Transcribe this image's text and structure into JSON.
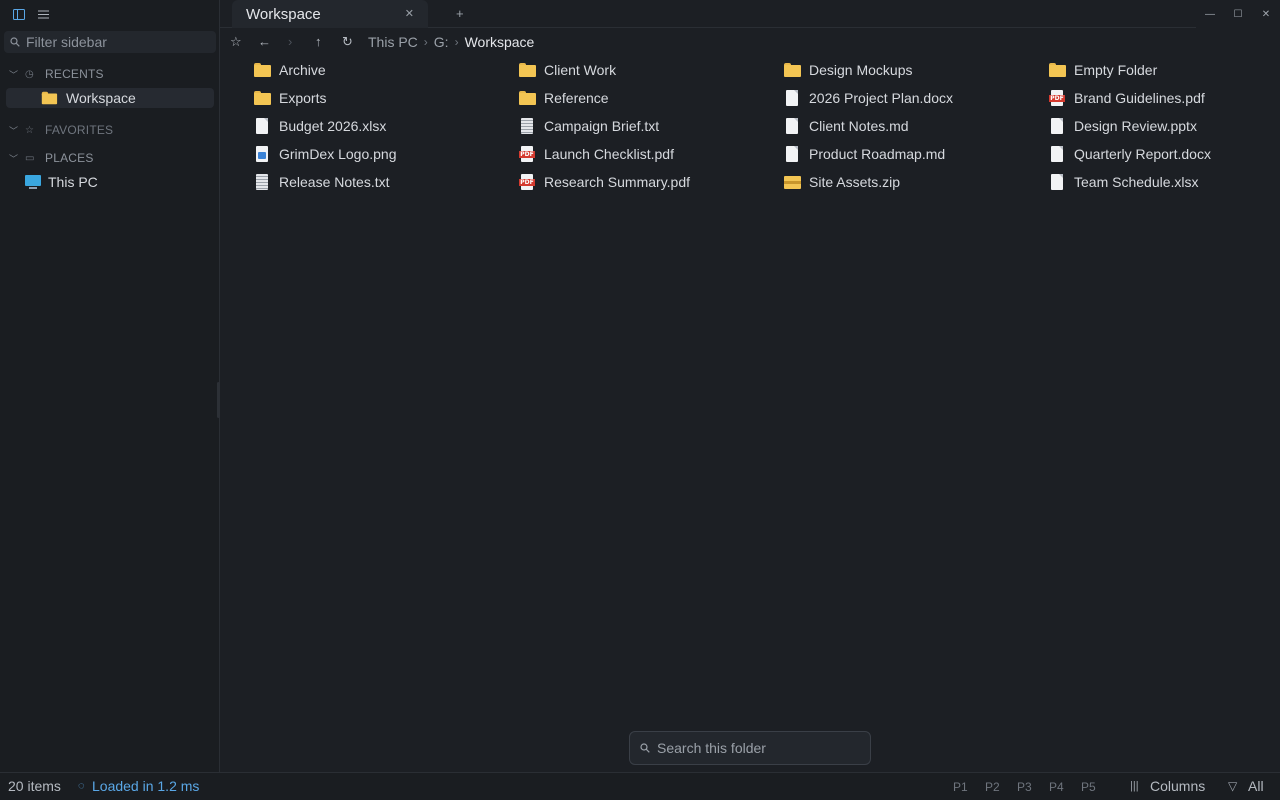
{
  "sidebar": {
    "filter_placeholder": "Filter sidebar",
    "sections": {
      "recents": "RECENTS",
      "favorites": "FAVORITES",
      "places": "PLACES"
    },
    "recent_items": [
      "Workspace"
    ],
    "place_items": [
      "This PC"
    ]
  },
  "tabs": {
    "active": "Workspace",
    "close_glyph": "✕",
    "new_glyph": "+"
  },
  "breadcrumb": [
    "This PC",
    "G:",
    "Workspace"
  ],
  "breadcrumb_sep": "›",
  "files": [
    {
      "name": "Archive",
      "type": "folder"
    },
    {
      "name": "Client Work",
      "type": "folder"
    },
    {
      "name": "Design Mockups",
      "type": "folder"
    },
    {
      "name": "Empty Folder",
      "type": "folder"
    },
    {
      "name": "Exports",
      "type": "folder"
    },
    {
      "name": "Reference",
      "type": "folder"
    },
    {
      "name": "2026 Project Plan.docx",
      "type": "doc"
    },
    {
      "name": "Brand Guidelines.pdf",
      "type": "pdf"
    },
    {
      "name": "Budget 2026.xlsx",
      "type": "doc"
    },
    {
      "name": "Campaign Brief.txt",
      "type": "txt"
    },
    {
      "name": "Client Notes.md",
      "type": "doc"
    },
    {
      "name": "Design Review.pptx",
      "type": "doc"
    },
    {
      "name": "GrimDex Logo.png",
      "type": "img"
    },
    {
      "name": "Launch Checklist.pdf",
      "type": "pdf"
    },
    {
      "name": "Product Roadmap.md",
      "type": "doc"
    },
    {
      "name": "Quarterly Report.docx",
      "type": "doc"
    },
    {
      "name": "Release Notes.txt",
      "type": "txt"
    },
    {
      "name": "Research Summary.pdf",
      "type": "pdf"
    },
    {
      "name": "Site Assets.zip",
      "type": "zip"
    },
    {
      "name": "Team Schedule.xlsx",
      "type": "doc"
    }
  ],
  "search": {
    "placeholder": "Search this folder"
  },
  "status": {
    "items": "20 items",
    "loaded": "Loaded in 1.2 ms",
    "panes": [
      "P1",
      "P2",
      "P3",
      "P4",
      "P5"
    ],
    "columns": "Columns",
    "filter": "All"
  },
  "colors": {
    "background": "#1c1f24",
    "accent": "#5aa7e6",
    "folder": "#f3c553",
    "pdf": "#d43a2f"
  }
}
